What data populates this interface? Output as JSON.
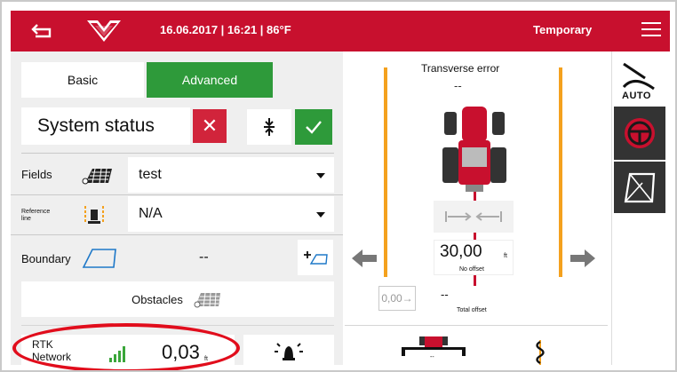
{
  "header": {
    "datetime": "16.06.2017 | 16:21 | 86°F",
    "mode": "Temporary"
  },
  "tabs": {
    "basic": "Basic",
    "advanced": "Advanced"
  },
  "system_status": {
    "label": "System status",
    "x_symbol": "✕"
  },
  "fields": {
    "label": "Fields",
    "value": "test"
  },
  "reference_line": {
    "label_line1": "Reference",
    "label_line2": "line",
    "value": "N/A"
  },
  "boundary": {
    "label": "Boundary",
    "value": "--"
  },
  "obstacles": {
    "label": "Obstacles"
  },
  "rtk": {
    "label_line1": "RTK",
    "label_line2": "Network",
    "value": "0,03",
    "unit": "ft"
  },
  "guidance": {
    "transverse_label": "Transverse error",
    "transverse_value": "--",
    "offset_value": "30,00",
    "offset_unit": "ft",
    "offset_sub": "No offset",
    "offset_step": "0,00→",
    "total_offset_value": "--",
    "total_offset_label": "Total offset",
    "implement_value": "--"
  },
  "sidebar": {
    "auto_label": "AUTO"
  },
  "colors": {
    "brand_red": "#c8102e",
    "green": "#2e9a3a",
    "orange": "#f4a11e",
    "highlight": "#e10d1c"
  }
}
